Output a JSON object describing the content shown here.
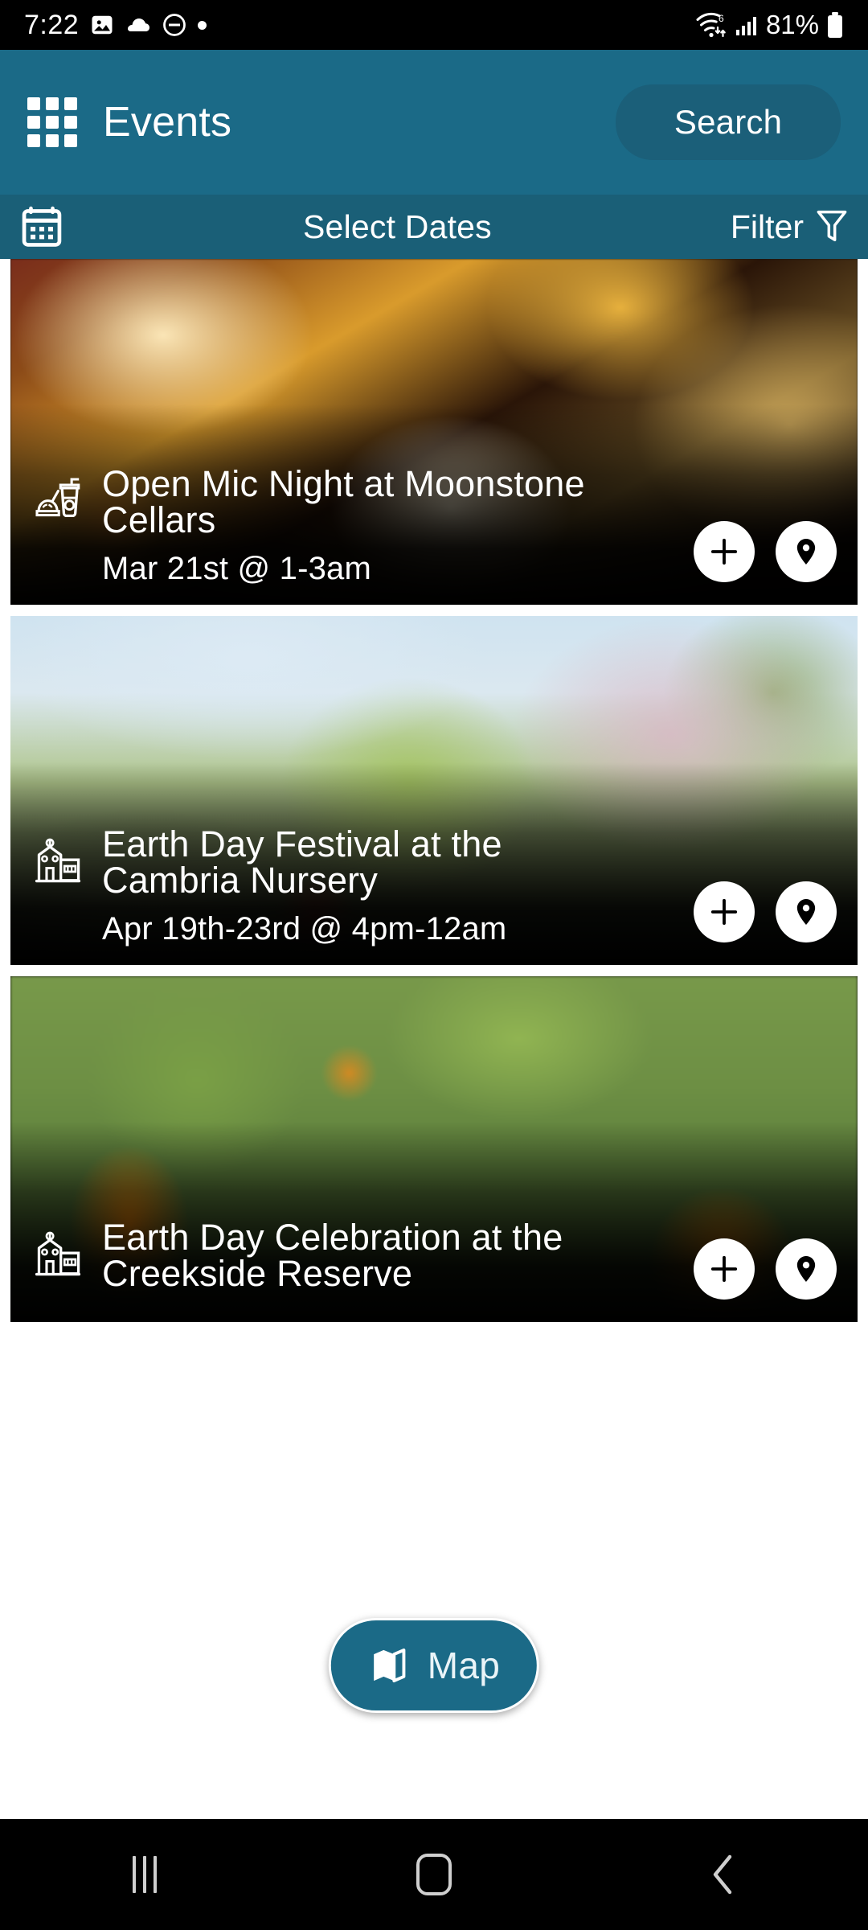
{
  "status_bar": {
    "time": "7:22",
    "left_icons": [
      "image-icon",
      "cloud-icon",
      "do-not-disturb-icon",
      "dot-icon"
    ],
    "right_icons": [
      "wifi-6-icon",
      "cellular-signal-icon"
    ],
    "battery_percent": "81%",
    "battery_icon": "battery-icon"
  },
  "header": {
    "grid_icon": "app-grid-icon",
    "title": "Events",
    "search_label": "Search"
  },
  "subbar": {
    "calendar_icon": "calendar-icon",
    "select_dates_label": "Select Dates",
    "filter_label": "Filter",
    "filter_icon": "funnel-icon"
  },
  "events": [
    {
      "category_icon": "food-and-drink-icon",
      "title": "Open Mic Night at Moonstone Cellars",
      "date": "Mar 21st @ 1-3am",
      "add_icon": "plus-icon",
      "location_icon": "map-pin-icon"
    },
    {
      "category_icon": "civic-building-icon",
      "title": "Earth Day Festival at the Cambria Nursery",
      "date": "Apr 19th-23rd @ 4pm-12am",
      "add_icon": "plus-icon",
      "location_icon": "map-pin-icon"
    },
    {
      "category_icon": "civic-building-icon",
      "title": "Earth Day Celebration at the Creekside Reserve",
      "date": "",
      "add_icon": "plus-icon",
      "location_icon": "map-pin-icon"
    }
  ],
  "map_fab": {
    "label": "Map",
    "icon": "folded-map-icon"
  },
  "nav_bar": {
    "recents_icon": "recents-icon",
    "home_icon": "home-icon",
    "back_icon": "back-icon"
  },
  "colors": {
    "header_teal": "#1b6a87",
    "subbar_teal": "#1a5f77",
    "search_pill": "#1b5f79",
    "status_bar_bg": "#000000",
    "card_bg": "#ffffff"
  }
}
